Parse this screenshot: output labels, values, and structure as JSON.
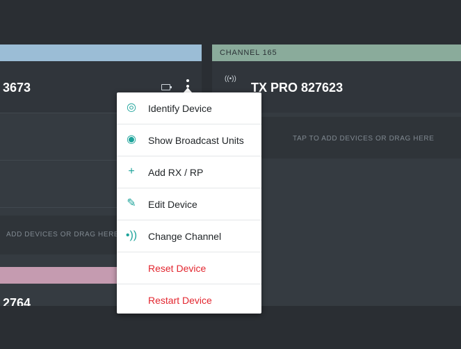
{
  "left_panel": {
    "device_name": "3673",
    "drop_text": "ADD DEVICES OR DRAG HERE",
    "partial_name": "2764"
  },
  "right_panel": {
    "channel_label": "CHANNEL 165",
    "broadcast_glyph": "((•))",
    "device_name": "TX PRO 827623",
    "drop_text": "TAP TO ADD DEVICES OR DRAG HERE"
  },
  "menu": {
    "items": [
      {
        "label": "Identify Device",
        "icon": "target-icon",
        "glyph": "◎",
        "style": "normal"
      },
      {
        "label": "Show Broadcast Units",
        "icon": "eye-icon",
        "glyph": "◉",
        "style": "normal"
      },
      {
        "label": "Add RX / RP",
        "icon": "plus-icon",
        "glyph": "+",
        "style": "normal"
      },
      {
        "label": "Edit Device",
        "icon": "pencil-icon",
        "glyph": "✎",
        "style": "normal"
      },
      {
        "label": "Change Channel",
        "icon": "broadcast-icon",
        "glyph": "•))",
        "style": "normal"
      },
      {
        "label": "Reset Device",
        "icon": "",
        "glyph": "",
        "style": "danger"
      },
      {
        "label": "Restart Device",
        "icon": "",
        "glyph": "",
        "style": "danger"
      }
    ]
  },
  "colors": {
    "background": "#2a2e33",
    "panel": "#353b41",
    "left_header": "#9bbdd6",
    "right_header": "#8aab9b",
    "pink_header": "#c59bb0",
    "accent_teal": "#1ca39a",
    "danger_red": "#e3262f"
  }
}
